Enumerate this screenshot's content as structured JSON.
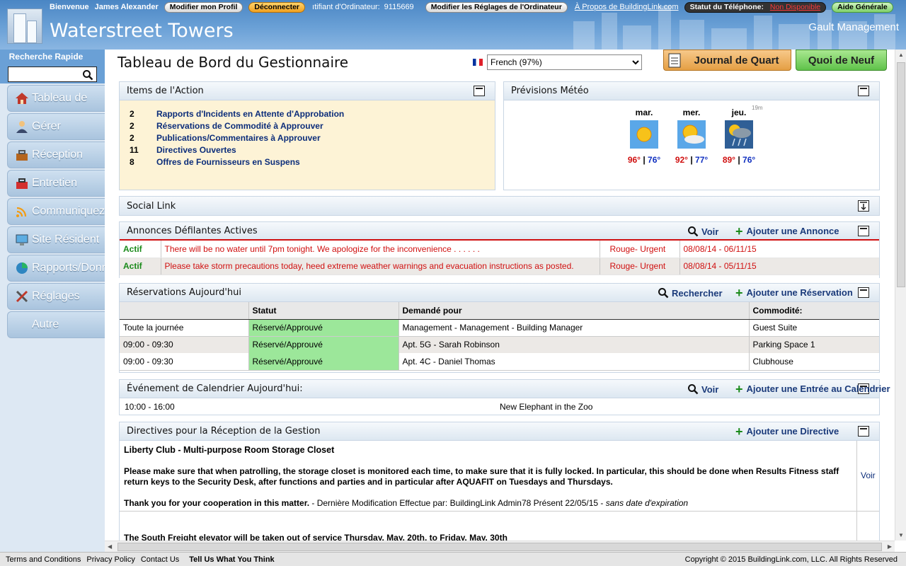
{
  "topbar": {
    "welcome": "Bienvenue",
    "user": "James Alexander",
    "edit_profile": "Modifier mon Profil",
    "logout": "Déconnecter",
    "computer_id_label": "ıtifiant d'Ordinateur:",
    "computer_id": "9115669",
    "edit_computer": "Modifier les Réglages de l'Ordinateur",
    "about": "À Propos de BuildingLink.com",
    "phone_status_label": "Statut du Téléphone:",
    "phone_status": "Non Disponible",
    "help": "Aide Générale"
  },
  "header": {
    "site_title": "Waterstreet Towers",
    "management": "Gault Management"
  },
  "sidebar": {
    "quick_search_label": "Recherche Rapide",
    "quick_search_value": "",
    "items": [
      {
        "label": "Tableau de",
        "icon": "house-icon"
      },
      {
        "label": "Gérer",
        "icon": "person-icon"
      },
      {
        "label": "Réception",
        "icon": "toolbox-icon"
      },
      {
        "label": "Entretien",
        "icon": "toolbox-red-icon"
      },
      {
        "label": "Communiquez",
        "icon": "wifi-icon"
      },
      {
        "label": "Site Résident",
        "icon": "monitor-icon"
      },
      {
        "label": "Rapports/Donn",
        "icon": "pie-chart-icon"
      },
      {
        "label": "Réglages",
        "icon": "tools-icon"
      },
      {
        "label": "Autre",
        "icon": ""
      }
    ]
  },
  "main": {
    "page_title": "Tableau de Bord du Gestionnaire",
    "language": "French (97%)",
    "journal_button": "Journal de Quart",
    "whats_new_button": "Quoi de Neuf"
  },
  "action_items": {
    "title": "Items de l'Action",
    "rows": [
      {
        "count": "2",
        "label": "Rapports d'Incidents en Attente d'Approbation"
      },
      {
        "count": "2",
        "label": "Réservations de Commodité à Approuver"
      },
      {
        "count": "2",
        "label": "Publications/Commentaires à Approuver"
      },
      {
        "count": "11",
        "label": "Directives Ouvertes"
      },
      {
        "count": "8",
        "label": "Offres de Fournisseurs en Suspens"
      }
    ]
  },
  "weather": {
    "title": "Prévisions Météo",
    "age": "19m",
    "days": [
      {
        "day": "mar.",
        "hi": "96°",
        "lo": "76°",
        "icon": "sunny-icon"
      },
      {
        "day": "mer.",
        "hi": "92°",
        "lo": "77°",
        "icon": "partly-cloudy-icon"
      },
      {
        "day": "jeu.",
        "hi": "89°",
        "lo": "76°",
        "icon": "storm-icon"
      }
    ]
  },
  "social": {
    "title": "Social Link"
  },
  "announcements": {
    "title": "Annonces Défilantes Actives",
    "view": "Voir",
    "add": "Ajouter une Annonce",
    "rows": [
      {
        "status": "Actif",
        "text": "There will be no water until 7pm tonight. We apologize for the inconvenience . . . . . .",
        "priority": "Rouge- Urgent",
        "dates": "08/08/14 - 06/11/15"
      },
      {
        "status": "Actif",
        "text": "Please take storm precautions today, heed extreme weather warnings and evacuation instructions as posted.",
        "priority": "Rouge- Urgent",
        "dates": "08/08/14 - 05/11/15"
      }
    ]
  },
  "reservations": {
    "title": "Réservations Aujourd'hui",
    "search": "Rechercher",
    "add": "Ajouter une Réservation",
    "columns": [
      "",
      "Statut",
      "Demandé pour",
      "Commodité:"
    ],
    "rows": [
      {
        "time": "Toute la journée",
        "status": "Réservé/Approuvé",
        "for": "Management - Management - Building Manager",
        "amenity": "Guest Suite"
      },
      {
        "time": "09:00 - 09:30",
        "status": "Réservé/Approuvé",
        "for": "Apt. 5G - Sarah Robinson",
        "amenity": "Parking Space 1"
      },
      {
        "time": "09:00 - 09:30",
        "status": "Réservé/Approuvé",
        "for": "Apt. 4C - Daniel Thomas",
        "amenity": "Clubhouse"
      }
    ]
  },
  "calendar": {
    "title": "Événement de Calendrier Aujourd'hui:",
    "view": "Voir",
    "add": "Ajouter une Entrée au Calendrier",
    "rows": [
      {
        "time": "10:00 - 16:00",
        "event": "New Elephant in the Zoo"
      }
    ]
  },
  "directives": {
    "title": "Directives pour la Réception de la Gestion",
    "add": "Ajouter une Directive",
    "heading": "Liberty Club - Multi-purpose Room Storage Closet",
    "body": "Please make sure that when patrolling, the storage closet is monitored each time, to make sure that it is fully locked. In particular, this should be done when Results Fitness staff return keys to the Security Desk, after functions and parties and in particular after AQUAFIT on Tuesdays and Thursdays.",
    "thanks": "Thank you for your cooperation in this matter.",
    "modified": " - Dernière Modification Effectue par: BuildingLink Admin78 Présent 22/05/15 - ",
    "expiry": "sans date d'expiration",
    "view": "Voir",
    "next_text": "The South Freight elevator will be taken out of service Thursday, May. 20th, to Friday, May. 30th"
  },
  "footer": {
    "terms": "Terms and Conditions",
    "privacy": "Privacy Policy",
    "contact": "Contact Us",
    "feedback": "Tell Us What You Think",
    "copyright": "Copyright © 2015 BuildingLink.com, LLC.   All Rights Reserved"
  }
}
